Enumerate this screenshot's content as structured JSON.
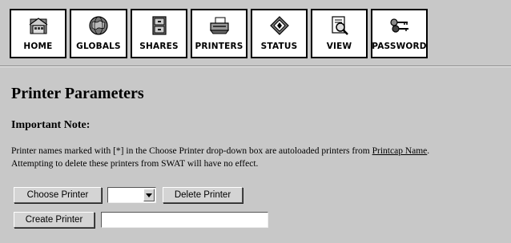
{
  "nav": {
    "home": "HOME",
    "globals": "GLOBALS",
    "shares": "SHARES",
    "printers": "PRINTERS",
    "status": "STATUS",
    "view": "VIEW",
    "password": "PASSWORD"
  },
  "page": {
    "title": "Printer Parameters",
    "note_title": "Important Note:",
    "note_part1": "Printer names marked with [*] in the Choose Printer drop-down box are autoloaded printers from ",
    "note_link": "Printcap Name",
    "note_part2": ".",
    "note_line2": "Attempting to delete these printers from SWAT will have no effect."
  },
  "form": {
    "choose_label": "Choose Printer",
    "printer_select_value": "",
    "delete_label": "Delete Printer",
    "create_label": "Create Printer",
    "create_value": ""
  },
  "icons": {
    "home": "house-icon",
    "globals": "globe-icon",
    "shares": "cabinet-icon",
    "printers": "printer-icon",
    "status": "diamond-icon",
    "view": "magnifier-icon",
    "password": "keys-icon"
  }
}
